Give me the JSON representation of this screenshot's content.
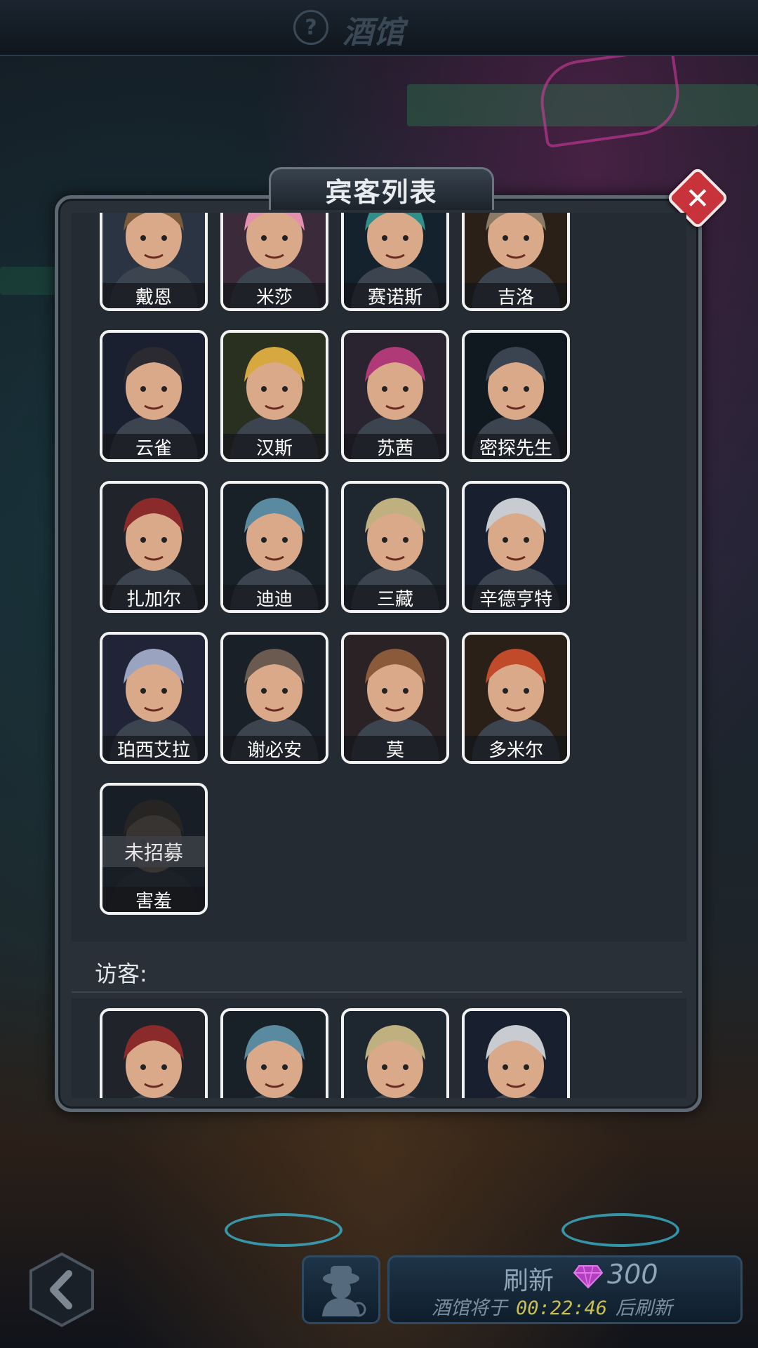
{
  "top_bar": {
    "title": "酒馆",
    "help_icon": "?"
  },
  "dialog": {
    "title": "宾客列表",
    "close_icon": "✕",
    "guests": [
      {
        "name": "戴恩",
        "icon": "bearded-warrior-portrait"
      },
      {
        "name": "米莎",
        "icon": "pink-hair-girl-portrait"
      },
      {
        "name": "赛诺斯",
        "icon": "helmet-robot-portrait"
      },
      {
        "name": "吉洛",
        "icon": "pug-portrait"
      },
      {
        "name": "云雀",
        "icon": "black-hair-girl-portrait"
      },
      {
        "name": "汉斯",
        "icon": "blonde-man-portrait"
      },
      {
        "name": "苏茜",
        "icon": "magenta-hair-girl-portrait"
      },
      {
        "name": "密探先生",
        "icon": "hat-robot-portrait"
      },
      {
        "name": "扎加尔",
        "icon": "red-armored-portrait"
      },
      {
        "name": "迪迪",
        "icon": "horned-elf-portrait"
      },
      {
        "name": "三藏",
        "icon": "straw-hat-robot-portrait"
      },
      {
        "name": "辛德亨特",
        "icon": "wolf-portrait"
      },
      {
        "name": "珀西艾拉",
        "icon": "silver-hair-elf-portrait"
      },
      {
        "name": "谢必安",
        "icon": "bearded-man-portrait"
      },
      {
        "name": "莫",
        "icon": "laughing-woman-portrait"
      },
      {
        "name": "多米尔",
        "icon": "red-goggles-portrait"
      },
      {
        "name": "害羞",
        "icon": "shadow-portrait",
        "status": "未招募"
      }
    ],
    "visitor_label": "访客:",
    "visitors": [
      {
        "icon": "purple-orc-portrait"
      },
      {
        "icon": "orange-hair-pirate-portrait"
      },
      {
        "icon": "skull-helmet-portrait"
      },
      {
        "icon": "white-beard-goggles-portrait"
      }
    ]
  },
  "bottom_bar": {
    "back_icon": "‹",
    "spy_icon": "spy-icon",
    "refresh_label": "刷新",
    "refresh_cost": "300",
    "refresh_prefix": "酒馆将于",
    "refresh_timer": "00:22:46",
    "refresh_suffix": "后刷新",
    "gem_color": "#c040c8"
  },
  "colors": {
    "accent": "#c8323a",
    "timer": "#c9c050",
    "card_border": "#f2f2f2"
  }
}
